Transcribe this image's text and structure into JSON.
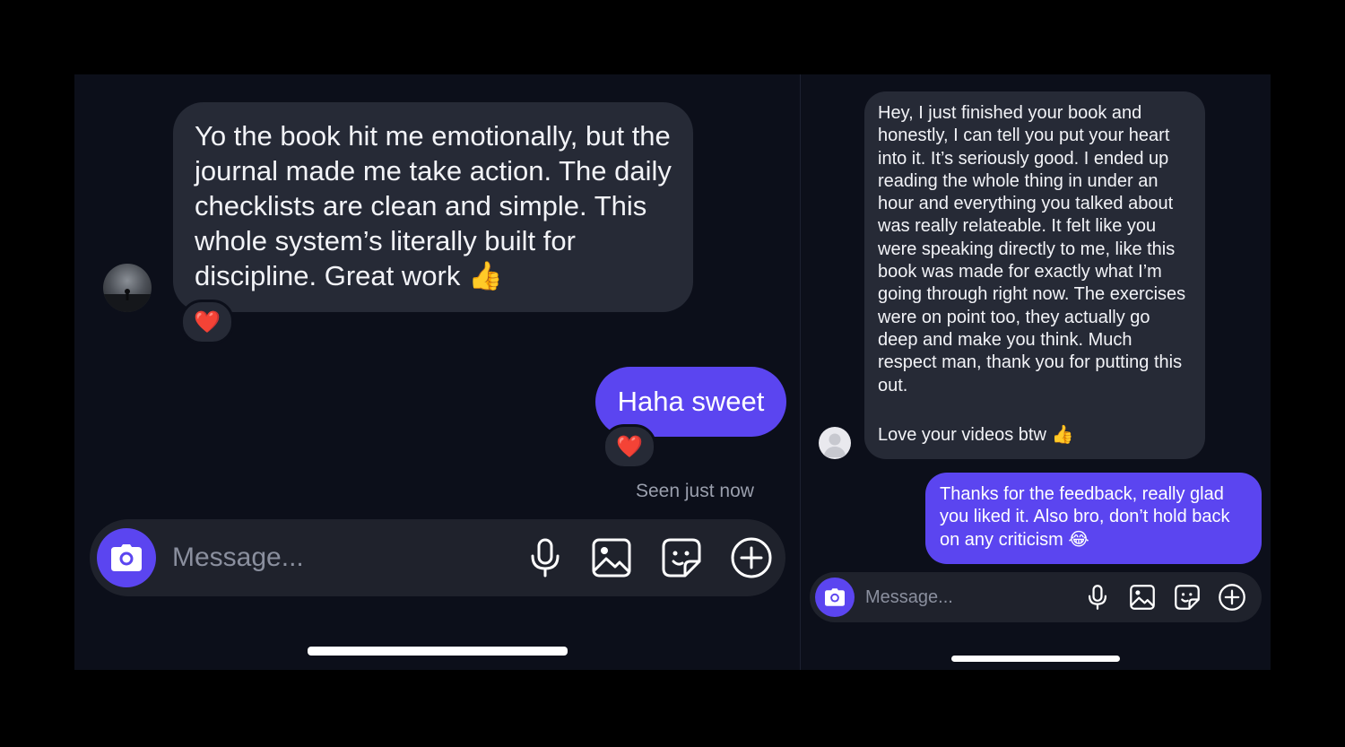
{
  "left": {
    "received_message": "Yo the book hit me emotionally, but the journal made me take action. The daily checklists are clean and simple. This whole system’s literally built for discipline. Great work 👍",
    "received_reaction": "❤️",
    "sent_message": "Haha sweet",
    "sent_reaction": "❤️",
    "seen_status": "Seen just now",
    "composer": {
      "placeholder": "Message..."
    }
  },
  "right": {
    "received_message": "Hey, I just finished your book and honestly, I can tell you put your heart into it. It’s seriously good. I ended up reading the whole thing in under an hour and everything you talked about was really relateable. It felt like you were speaking directly to me, like this book was made for exactly what I’m going through right now. The exercises were on point too, they actually go deep and make you think. Much respect man, thank you for putting this out.",
    "received_message_2": "Love your videos btw 👍",
    "sent_message": "Thanks for the feedback, really glad you liked it. Also bro, don’t hold back on any criticism 😂",
    "composer": {
      "placeholder": "Message..."
    }
  },
  "colors": {
    "panel_bg": "#0c0f1a",
    "incoming_bubble": "#262a36",
    "outgoing_bubble": "#5b45f0",
    "composer_bg": "#1f222c",
    "placeholder": "#8a8f9e"
  },
  "icons": [
    "camera-icon",
    "microphone-icon",
    "image-icon",
    "sticker-icon",
    "plus-circle-icon",
    "heart-reaction-icon"
  ]
}
